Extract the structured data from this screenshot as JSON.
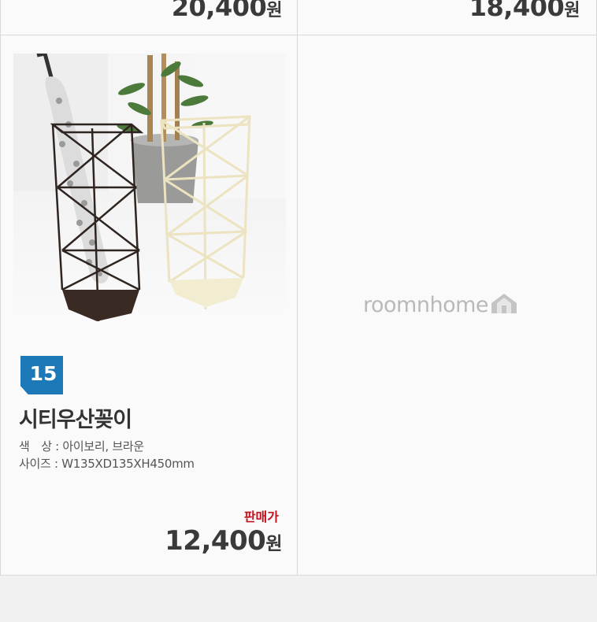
{
  "top_row": {
    "left_price": "20,400",
    "right_price": "18,400",
    "currency": "원"
  },
  "product": {
    "number": "15",
    "name": "시티우산꽂이",
    "color_label": "색　상 : ",
    "color_value": "아이보리, 브라운",
    "size_label": "사이즈 : ",
    "size_value": "W135XD135XH450mm",
    "sale_label": "판매가",
    "price": "12,400",
    "currency": "원"
  },
  "placeholder": {
    "logo_text": "roomnhome",
    "logo_icon": "house-icon"
  },
  "colors": {
    "badge": "#1d78b8",
    "sale_label": "#c0121e",
    "logo": "#b9b9b9"
  }
}
